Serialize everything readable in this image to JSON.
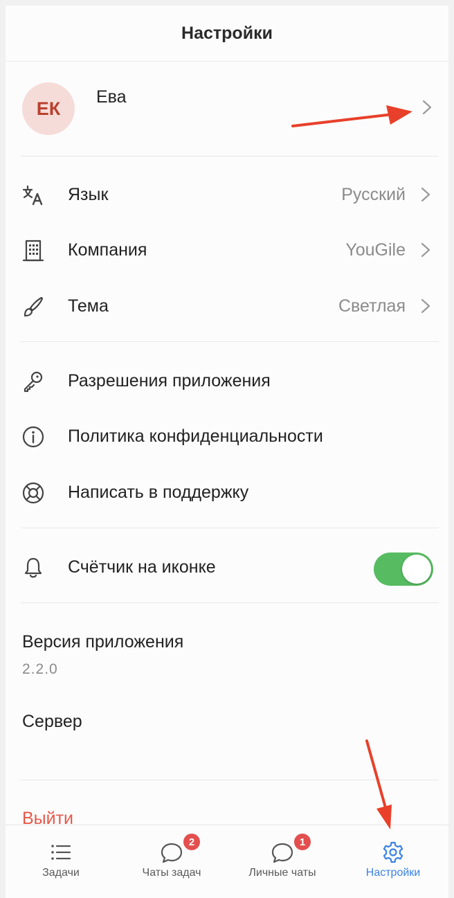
{
  "header": {
    "title": "Настройки"
  },
  "profile": {
    "initials": "ЕК",
    "name": "Ева"
  },
  "settings": [
    {
      "label": "Язык",
      "value": "Русский",
      "icon": "translate-icon"
    },
    {
      "label": "Компания",
      "value": "YouGile",
      "icon": "building-icon"
    },
    {
      "label": "Тема",
      "value": "Светлая",
      "icon": "brush-icon"
    }
  ],
  "links": [
    {
      "label": "Разрешения приложения",
      "icon": "key-icon"
    },
    {
      "label": "Политика конфиденциальности",
      "icon": "info-icon"
    },
    {
      "label": "Написать в поддержку",
      "icon": "lifebuoy-icon"
    }
  ],
  "counter": {
    "label": "Счётчик на иконке",
    "enabled": true,
    "icon": "bell-icon"
  },
  "version": {
    "label": "Версия приложения",
    "value": "2.2.0"
  },
  "server": {
    "label": "Сервер"
  },
  "logout": {
    "label": "Выйти"
  },
  "tabs": [
    {
      "label": "Задачи",
      "icon": "list-icon"
    },
    {
      "label": "Чаты задач",
      "icon": "chat-icon",
      "badge": "2"
    },
    {
      "label": "Личные чаты",
      "icon": "chat-icon",
      "badge": "1"
    },
    {
      "label": "Настройки",
      "icon": "gear-icon",
      "active": true
    }
  ],
  "colors": {
    "accent": "#3a82e6",
    "toggle_on": "#57bb62",
    "logout": "#e8574a",
    "badge": "#e34f4f",
    "avatar_bg": "#f6dcd8",
    "avatar_text": "#b9402e",
    "annotation_arrow": "#e8402a"
  }
}
